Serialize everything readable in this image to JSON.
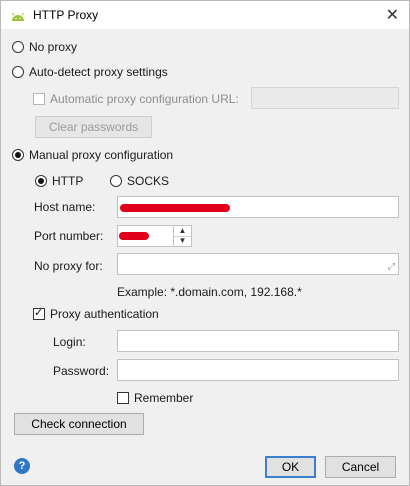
{
  "window": {
    "title": "HTTP Proxy",
    "close_glyph": "✕"
  },
  "options": {
    "no_proxy": "No proxy",
    "auto_detect": "Auto-detect proxy settings",
    "auto_config_url": "Automatic proxy configuration URL:",
    "clear_passwords": "Clear passwords",
    "manual": "Manual proxy configuration"
  },
  "protocol": {
    "http": "HTTP",
    "socks": "SOCKS",
    "selected": "HTTP"
  },
  "fields": {
    "host_name_label": "Host name:",
    "port_number_label": "Port number:",
    "no_proxy_for_label": "No proxy for:",
    "example_text": "Example: *.domain.com, 192.168.*",
    "proxy_auth_label": "Proxy authentication",
    "login_label": "Login:",
    "password_label": "Password:",
    "remember_label": "Remember"
  },
  "state": {
    "selected_mode": "manual",
    "proxy_auth_checked": true,
    "remember_checked": false,
    "auto_url_checked": false
  },
  "buttons": {
    "check_connection": "Check connection",
    "ok": "OK",
    "cancel": "Cancel"
  },
  "colors": {
    "accent": "#3c7fd1",
    "help": "#2f76c6",
    "redaction": "#e0001b"
  },
  "icons": {
    "app": "android-icon",
    "close": "close-icon",
    "help": "help-icon",
    "expand": "expand-icon"
  }
}
